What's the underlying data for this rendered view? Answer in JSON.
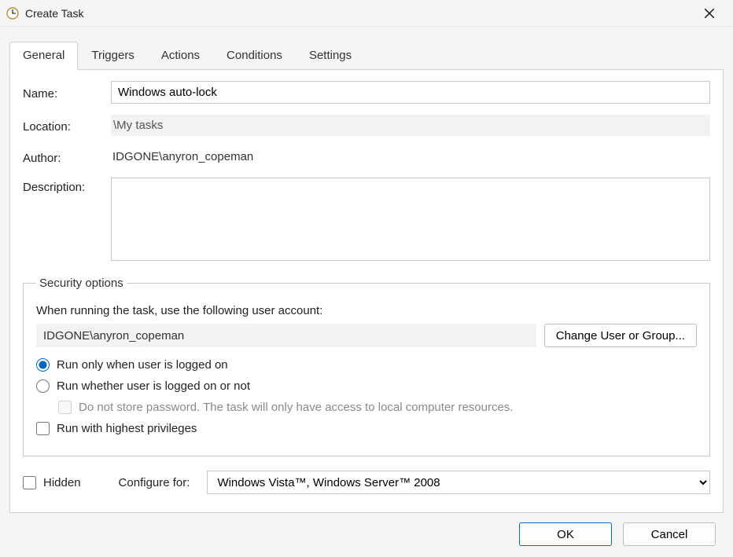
{
  "window": {
    "title": "Create Task"
  },
  "tabs": [
    {
      "label": "General"
    },
    {
      "label": "Triggers"
    },
    {
      "label": "Actions"
    },
    {
      "label": "Conditions"
    },
    {
      "label": "Settings"
    }
  ],
  "fields": {
    "name_label": "Name:",
    "name_value": "Windows auto-lock",
    "location_label": "Location:",
    "location_value": "\\My tasks",
    "author_label": "Author:",
    "author_value": "IDGONE\\anyron_copeman",
    "description_label": "Description:",
    "description_value": ""
  },
  "security": {
    "legend": "Security options",
    "when_running": "When running the task, use the following user account:",
    "account": "IDGONE\\anyron_copeman",
    "change_user_btn": "Change User or Group...",
    "radio_logged_on": "Run only when user is logged on",
    "radio_whether": "Run whether user is logged on or not",
    "checkbox_nostore": "Do not store password.  The task will only have access to local computer resources.",
    "checkbox_highest": "Run with highest privileges"
  },
  "bottom": {
    "hidden_label": "Hidden",
    "configure_label": "Configure for:",
    "configure_value": "Windows Vista™, Windows Server™ 2008"
  },
  "buttons": {
    "ok": "OK",
    "cancel": "Cancel"
  }
}
